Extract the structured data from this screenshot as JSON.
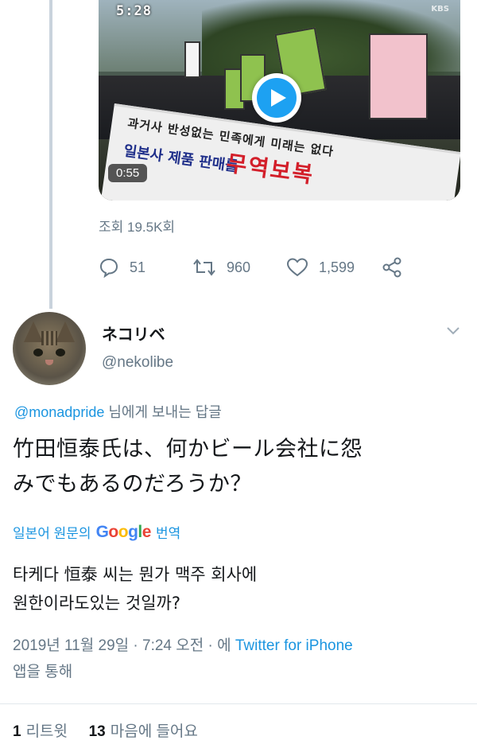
{
  "video": {
    "clock_overlay": "5:28",
    "channel_logo": "KBS",
    "duration": "0:55",
    "banner_line1": "과거사 반성없는 민족에게 미래는 없다",
    "banner_line2": "무역보복",
    "banner_line3": "일본사 제품 판매를",
    "play_icon": "play-icon"
  },
  "parent_tweet": {
    "views": "조회 19.5K회",
    "reply_count": "51",
    "retweet_count": "960",
    "like_count": "1,599"
  },
  "tweet": {
    "display_name": "ネコリベ",
    "handle": "@nekolibe",
    "reply_to_mention": "@monadpride",
    "reply_to_suffix": "님에게 보내는 답글",
    "text_line1": "竹田恒泰氏は、何かビール会社に怨",
    "text_line2": "みでもあるのだろうか？",
    "translate_prefix": "일본어 원문의",
    "translate_suffix": "번역",
    "google_brand": [
      "G",
      "o",
      "o",
      "g",
      "l",
      "e"
    ],
    "translated_line1": "타케다 恒泰 씨는 뭔가 맥주 회사에",
    "translated_line2": "원한이라도있는 것일까?",
    "meta_date": "2019년 11월 29일 · 7:24 오전 · 에",
    "meta_app": "Twitter for iPhone",
    "meta_suffix": "앱을 통해",
    "retweets_count": "1",
    "retweets_label": "리트윗",
    "likes_count": "13",
    "likes_label": "마음에 들어요"
  },
  "colors": {
    "accent": "#1b95e0",
    "play_blue": "#1da1f2",
    "secondary_text": "#657786",
    "primary_text": "#14171a",
    "thread_line": "#c9d3dc"
  }
}
